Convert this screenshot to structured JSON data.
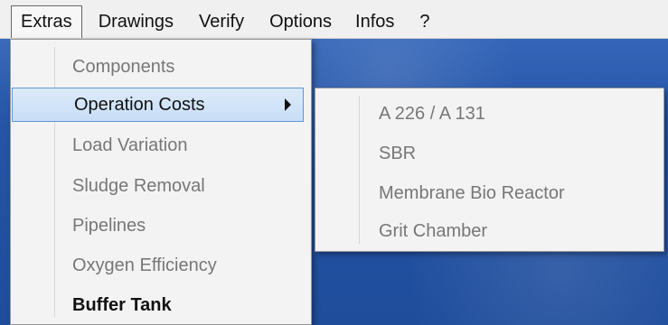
{
  "menubar": {
    "items": [
      {
        "label": "Extras"
      },
      {
        "label": "Drawings"
      },
      {
        "label": "Verify"
      },
      {
        "label": "Options"
      },
      {
        "label": "Infos"
      },
      {
        "label": "?"
      }
    ]
  },
  "extras_menu": {
    "items": [
      {
        "label": "Components"
      },
      {
        "label": "Operation Costs"
      },
      {
        "label": "Load Variation"
      },
      {
        "label": "Sludge Removal"
      },
      {
        "label": "Pipelines"
      },
      {
        "label": "Oxygen Efficiency"
      },
      {
        "label": "Buffer Tank"
      }
    ]
  },
  "operation_costs_submenu": {
    "items": [
      {
        "label": "A 226 / A 131"
      },
      {
        "label": "SBR"
      },
      {
        "label": "Membrane Bio Reactor"
      },
      {
        "label": "Grit Chamber"
      }
    ]
  },
  "colors": {
    "menu_highlight": "#c8def7",
    "menu_highlight_border": "#5e97d8",
    "background_blue": "#2554a6"
  },
  "icons": {
    "submenu_arrow": "chevron-right-icon"
  }
}
